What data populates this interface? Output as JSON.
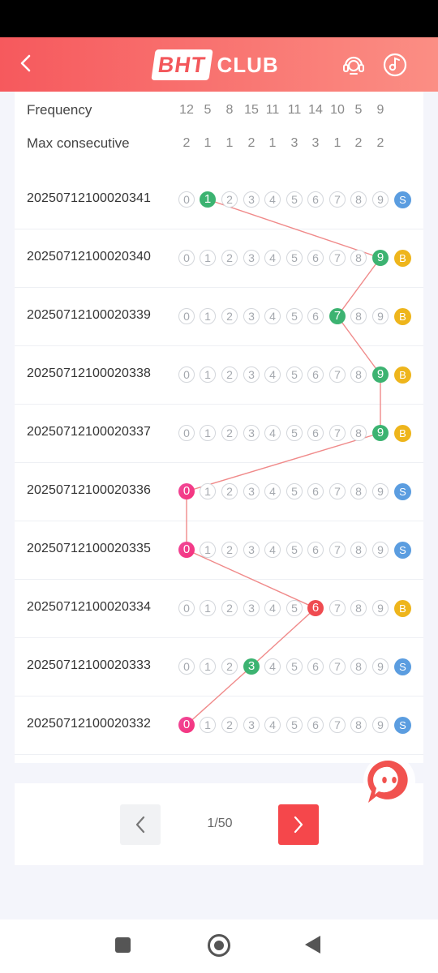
{
  "header": {
    "logo_primary": "BHT",
    "logo_secondary": "CLUB"
  },
  "stats": {
    "frequency_label": "Frequency",
    "frequency": [
      "12",
      "5",
      "8",
      "15",
      "11",
      "11",
      "14",
      "10",
      "5",
      "9"
    ],
    "max_consecutive_label": "Max consecutive",
    "max_consecutive": [
      "2",
      "1",
      "1",
      "2",
      "1",
      "3",
      "3",
      "1",
      "2",
      "2"
    ]
  },
  "digits": [
    "0",
    "1",
    "2",
    "3",
    "4",
    "5",
    "6",
    "7",
    "8",
    "9"
  ],
  "draws": [
    {
      "issue": "20250712100020341",
      "number": 1,
      "size": "S"
    },
    {
      "issue": "20250712100020340",
      "number": 9,
      "size": "B"
    },
    {
      "issue": "20250712100020339",
      "number": 7,
      "size": "B"
    },
    {
      "issue": "20250712100020338",
      "number": 9,
      "size": "B"
    },
    {
      "issue": "20250712100020337",
      "number": 9,
      "size": "B"
    },
    {
      "issue": "20250712100020336",
      "number": 0,
      "size": "S"
    },
    {
      "issue": "20250712100020335",
      "number": 0,
      "size": "S"
    },
    {
      "issue": "20250712100020334",
      "number": 6,
      "size": "B"
    },
    {
      "issue": "20250712100020333",
      "number": 3,
      "size": "S"
    },
    {
      "issue": "20250712100020332",
      "number": 0,
      "size": "S"
    }
  ],
  "colors": {
    "header_start": "#f6595d",
    "header_end": "#fb8e84",
    "hit_green": "#3cb371",
    "hit_zero": "linear-gradient(135deg,#f0499a,#f5307a)",
    "hit_red": "#ef4b50",
    "badge_small": "#5b9de0",
    "badge_big": "#eeb51c",
    "trend_line": "#f08a8a",
    "next_button": "#f5474b"
  },
  "pagination": {
    "page_text": "1/50"
  }
}
